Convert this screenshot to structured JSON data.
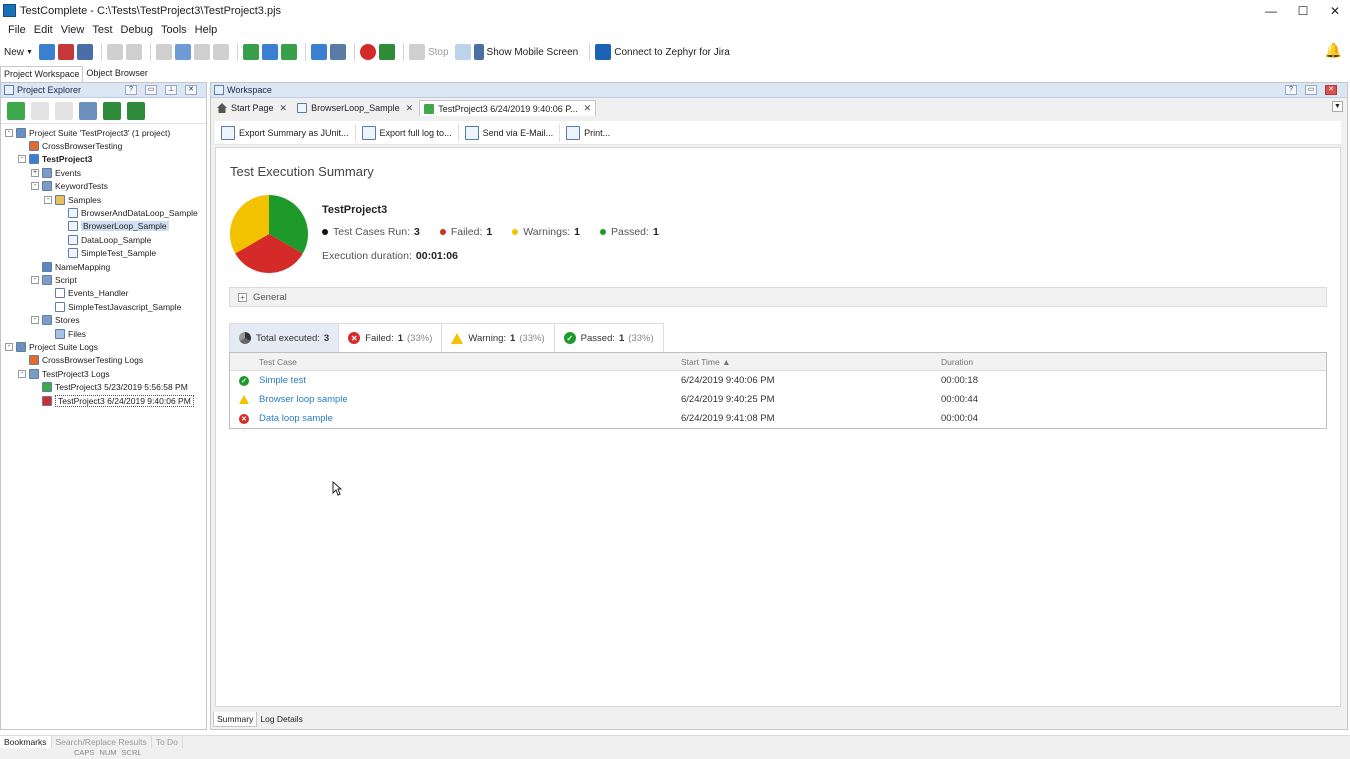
{
  "window": {
    "title": "TestComplete - C:\\Tests\\TestProject3\\TestProject3.pjs",
    "minimize": "—",
    "maximize": "☐",
    "close": "✕"
  },
  "menu": [
    "File",
    "Edit",
    "View",
    "Test",
    "Debug",
    "Tools",
    "Help"
  ],
  "toolbar": {
    "new_label": "New",
    "stop_label": "Stop",
    "show_mobile_label": "Show Mobile Screen",
    "connect_label": "Connect to",
    "zephyr_label": "Zephyr for Jira"
  },
  "panel_tabs": [
    "Project Workspace",
    "Object Browser"
  ],
  "project_explorer": {
    "title": "Project Explorer",
    "tree": [
      {
        "label": "Project Suite 'TestProject3' (1 project)",
        "level": 0,
        "exp": "-",
        "icon": "suite"
      },
      {
        "label": "CrossBrowserTesting",
        "level": 1,
        "exp": "",
        "icon": "cbt"
      },
      {
        "label": "TestProject3",
        "level": 1,
        "exp": "-",
        "icon": "project",
        "bold": true
      },
      {
        "label": "Events",
        "level": 2,
        "exp": "+",
        "icon": "folder"
      },
      {
        "label": "KeywordTests",
        "level": 2,
        "exp": "-",
        "icon": "folder"
      },
      {
        "label": "Samples",
        "level": 3,
        "exp": "-",
        "icon": "yfolder"
      },
      {
        "label": "BrowserAndDataLoop_Sample",
        "level": 4,
        "exp": "",
        "icon": "kw"
      },
      {
        "label": "BrowserLoop_Sample",
        "level": 4,
        "exp": "",
        "icon": "kw",
        "selected": true
      },
      {
        "label": "DataLoop_Sample",
        "level": 4,
        "exp": "",
        "icon": "kw"
      },
      {
        "label": "SimpleTest_Sample",
        "level": 4,
        "exp": "",
        "icon": "kw"
      },
      {
        "label": "NameMapping",
        "level": 2,
        "exp": "",
        "icon": "map"
      },
      {
        "label": "Script",
        "level": 2,
        "exp": "-",
        "icon": "folder"
      },
      {
        "label": "Events_Handler",
        "level": 3,
        "exp": "",
        "icon": "script"
      },
      {
        "label": "SimpleTestJavascript_Sample",
        "level": 3,
        "exp": "",
        "icon": "script"
      },
      {
        "label": "Stores",
        "level": 2,
        "exp": "-",
        "icon": "folder"
      },
      {
        "label": "Files",
        "level": 3,
        "exp": "",
        "icon": "files"
      },
      {
        "label": "Project Suite Logs",
        "level": 0,
        "exp": "-",
        "icon": "suite"
      },
      {
        "label": "CrossBrowserTesting Logs",
        "level": 1,
        "exp": "",
        "icon": "cbt"
      },
      {
        "label": "TestProject3 Logs",
        "level": 1,
        "exp": "-",
        "icon": "logs"
      },
      {
        "label": "TestProject3 5/23/2019 5:56:58 PM",
        "level": 2,
        "exp": "",
        "icon": "logok"
      },
      {
        "label": "TestProject3 6/24/2019 9:40:06 PM",
        "level": 2,
        "exp": "",
        "icon": "logfail",
        "focused": true
      }
    ]
  },
  "workspace": {
    "title": "Workspace",
    "tabs": [
      {
        "label": "Start Page",
        "icon": "home"
      },
      {
        "label": "BrowserLoop_Sample",
        "icon": "kw"
      },
      {
        "label": "TestProject3 6/24/2019 9:40:06 P...",
        "icon": "log",
        "active": true
      }
    ],
    "report_toolbar": [
      "Export Summary as JUnit...",
      "Export full log to...",
      "Send via E-Mail...",
      "Print..."
    ]
  },
  "summary": {
    "heading": "Test Execution Summary",
    "project": "TestProject3",
    "stats": [
      {
        "label": "Test Cases Run:",
        "value": "3",
        "color": "#111111"
      },
      {
        "label": "Failed:",
        "value": "1",
        "color": "#d42a2a"
      },
      {
        "label": "Warnings:",
        "value": "1",
        "color": "#f2c200"
      },
      {
        "label": "Passed:",
        "value": "1",
        "color": "#1d9a2a"
      }
    ],
    "duration_label": "Execution duration:",
    "duration_value": "00:01:06",
    "pie": [
      {
        "name": "Passed",
        "value": 1,
        "color": "#1d9a2a"
      },
      {
        "name": "Failed",
        "value": 1,
        "color": "#d42a2a"
      },
      {
        "name": "Warning",
        "value": 1,
        "color": "#f2c200"
      }
    ],
    "general_label": "General",
    "filters": [
      {
        "label": "Total executed:",
        "value": "3",
        "pct": "",
        "icon": "pie",
        "active": true
      },
      {
        "label": "Failed:",
        "value": "1",
        "pct": "(33%)",
        "icon": "fail"
      },
      {
        "label": "Warning:",
        "value": "1",
        "pct": "(33%)",
        "icon": "warn"
      },
      {
        "label": "Passed:",
        "value": "1",
        "pct": "(33%)",
        "icon": "pass"
      }
    ],
    "columns": {
      "name": "Test Case",
      "time": "Start Time ▲",
      "duration": "Duration"
    },
    "rows": [
      {
        "status": "pass",
        "name": "Simple test",
        "time": "6/24/2019 9:40:06 PM",
        "duration": "00:00:18"
      },
      {
        "status": "warn",
        "name": "Browser loop sample",
        "time": "6/24/2019 9:40:25 PM",
        "duration": "00:00:44"
      },
      {
        "status": "fail",
        "name": "Data loop sample",
        "time": "6/24/2019 9:41:08 PM",
        "duration": "00:00:04"
      }
    ]
  },
  "bottom_tabs": [
    "Summary",
    "Log Details"
  ],
  "status_tabs": [
    "Bookmarks",
    "Search/Replace Results",
    "To Do"
  ],
  "statusbar": [
    "CAPS",
    "NUM",
    "SCRL"
  ]
}
